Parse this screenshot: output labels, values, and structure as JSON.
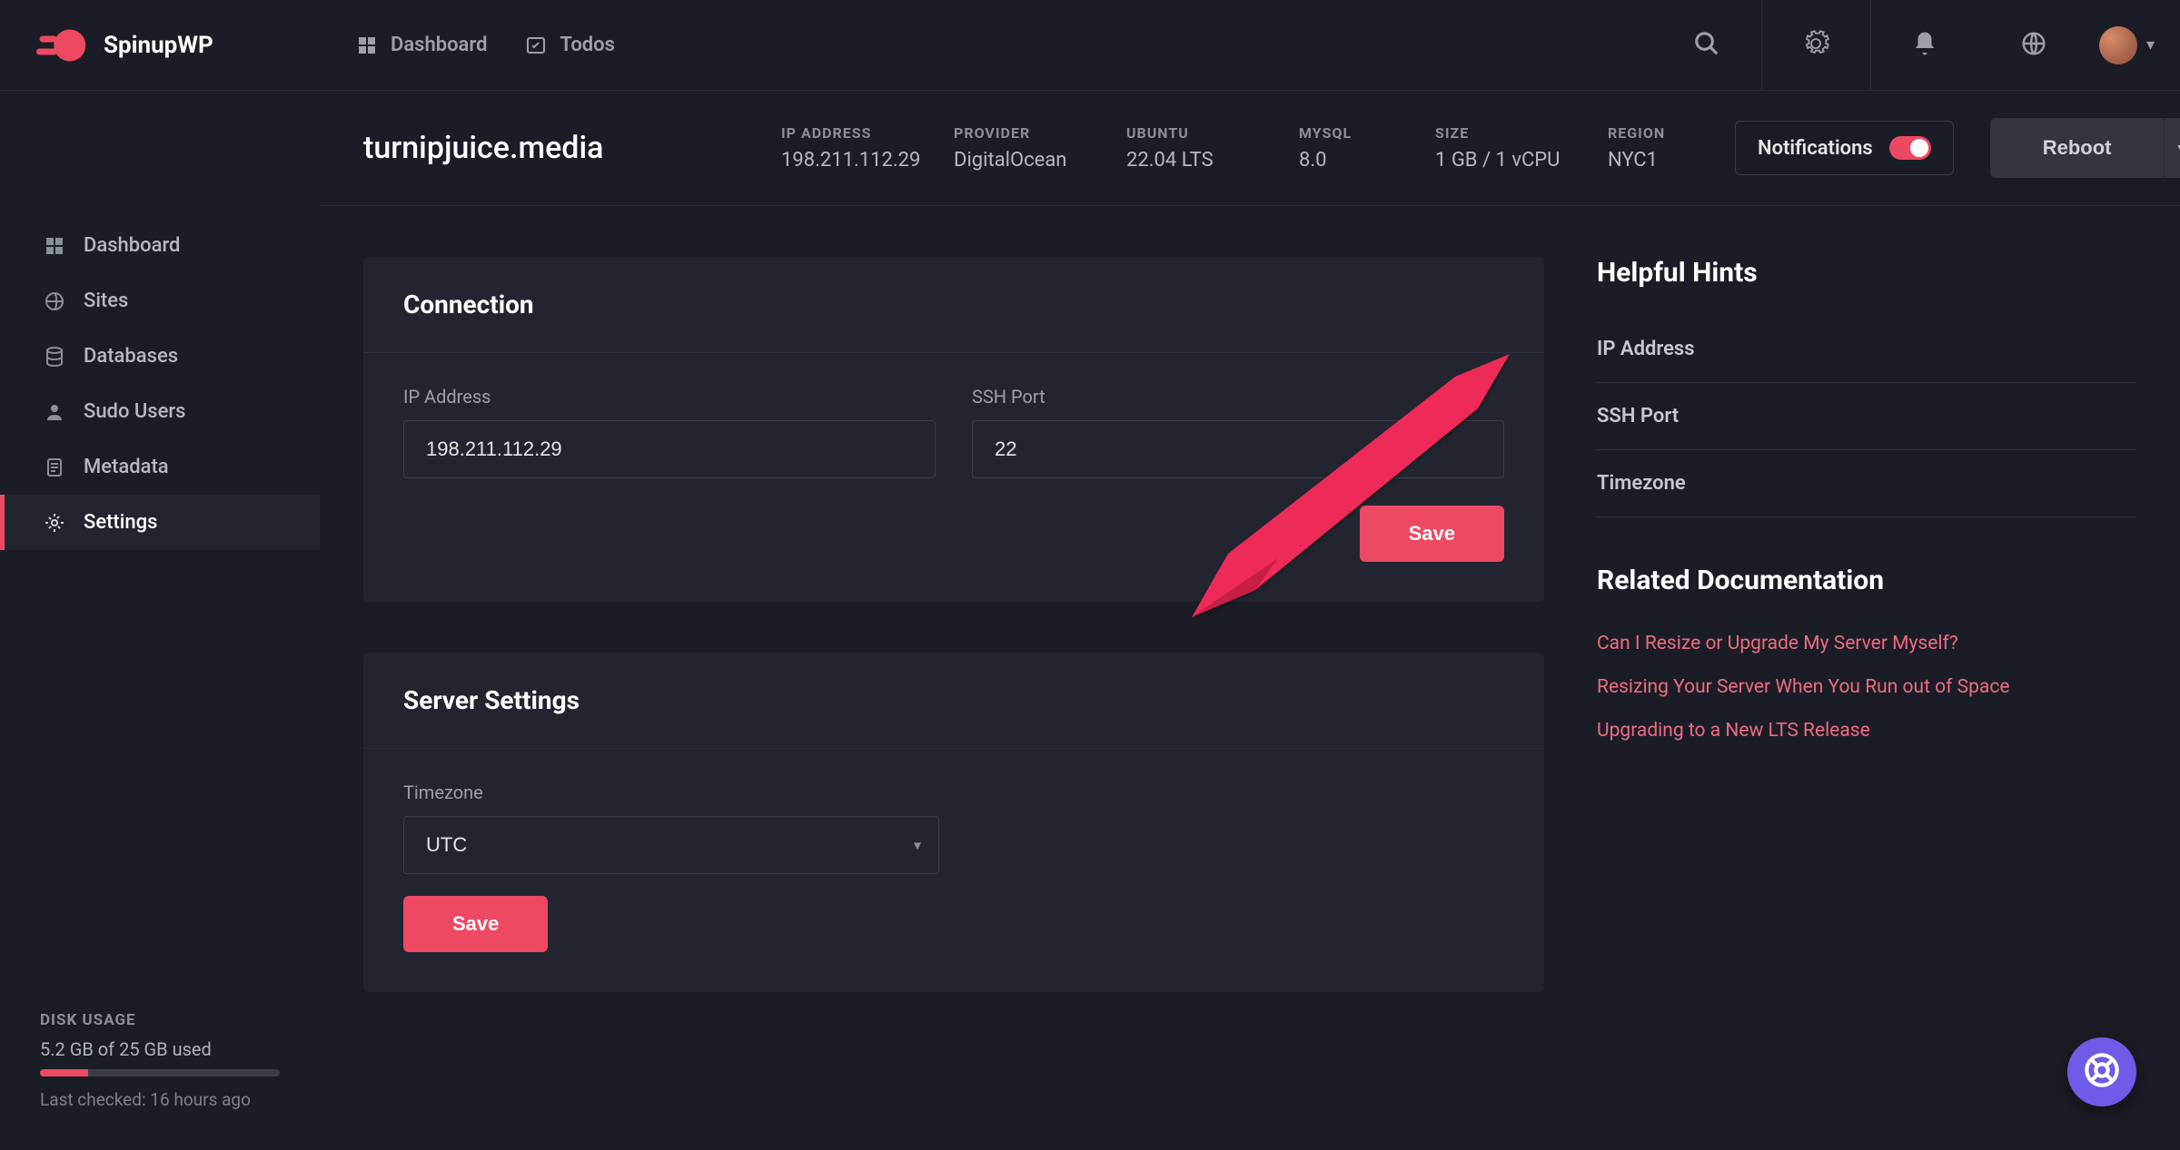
{
  "brand": "SpinupWP",
  "topnav": {
    "dashboard": "Dashboard",
    "todos": "Todos"
  },
  "sidebar": {
    "items": [
      {
        "label": "Dashboard"
      },
      {
        "label": "Sites"
      },
      {
        "label": "Databases"
      },
      {
        "label": "Sudo Users"
      },
      {
        "label": "Metadata"
      },
      {
        "label": "Settings"
      }
    ]
  },
  "disk": {
    "title": "DISK USAGE",
    "usage_text": "5.2 GB of 25 GB used",
    "last_checked": "Last checked: 16 hours ago"
  },
  "server": {
    "name": "turnipjuice.media",
    "stats": {
      "ip_label": "IP ADDRESS",
      "ip_value": "198.211.112.29",
      "provider_label": "PROVIDER",
      "provider_value": "DigitalOcean",
      "ubuntu_label": "UBUNTU",
      "ubuntu_value": "22.04 LTS",
      "mysql_label": "MYSQL",
      "mysql_value": "8.0",
      "size_label": "SIZE",
      "size_value": "1 GB / 1 vCPU",
      "region_label": "REGION",
      "region_value": "NYC1"
    },
    "notifications_label": "Notifications",
    "reboot_label": "Reboot"
  },
  "connection": {
    "title": "Connection",
    "ip_label": "IP Address",
    "ip_value": "198.211.112.29",
    "ssh_label": "SSH Port",
    "ssh_value": "22",
    "save": "Save"
  },
  "server_settings": {
    "title": "Server Settings",
    "tz_label": "Timezone",
    "tz_value": "UTC",
    "save": "Save"
  },
  "hints": {
    "title": "Helpful Hints",
    "items": [
      "IP Address",
      "SSH Port",
      "Timezone"
    ]
  },
  "docs": {
    "title": "Related Documentation",
    "links": [
      "Can I Resize or Upgrade My Server Myself?",
      "Resizing Your Server When You Run out of Space",
      "Upgrading to a New LTS Release"
    ]
  }
}
